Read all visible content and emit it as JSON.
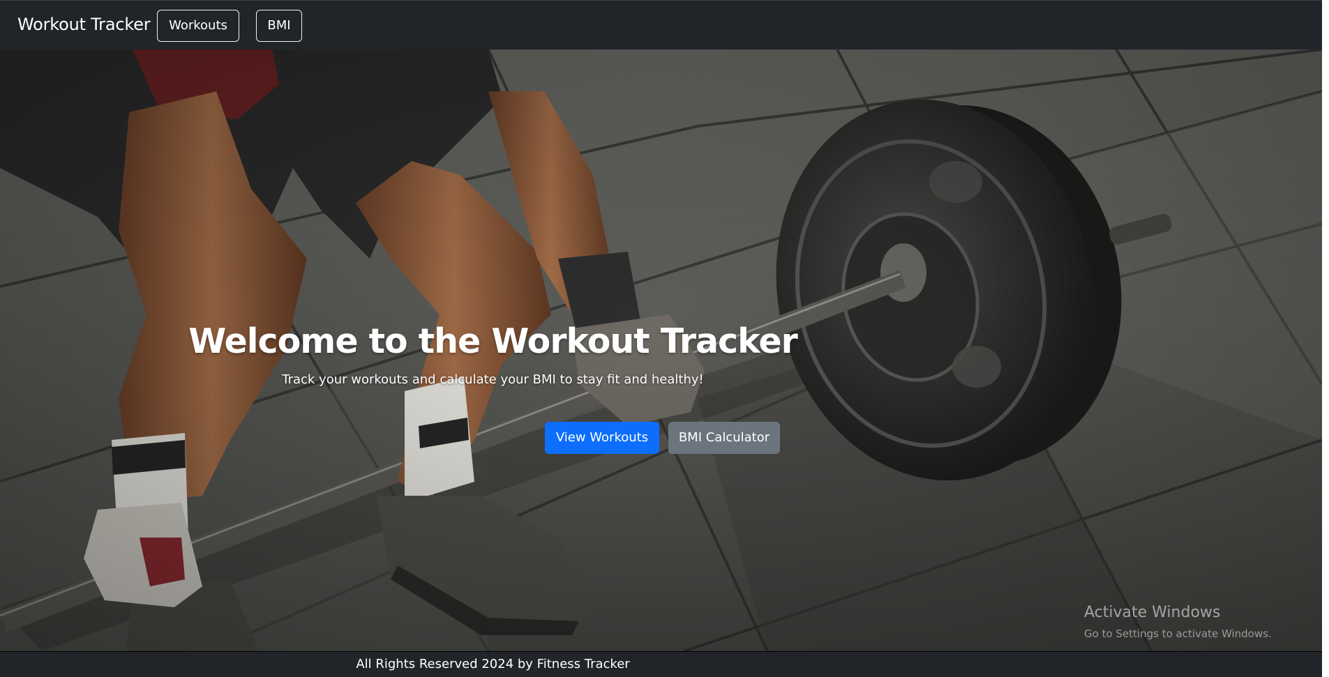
{
  "navbar": {
    "brand": "Workout Tracker",
    "links": [
      {
        "label": "Workouts"
      },
      {
        "label": "BMI"
      }
    ]
  },
  "hero": {
    "title": "Welcome to the Workout Tracker",
    "subtitle": "Track your workouts and calculate your BMI to stay fit and healthy!",
    "buttons": [
      {
        "label": "View Workouts"
      },
      {
        "label": "BMI Calculator"
      }
    ],
    "background_image": "barbell-deadlift-photo"
  },
  "watermark": {
    "title": "Activate Windows",
    "subtitle": "Go to Settings to activate Windows."
  },
  "footer": {
    "text": "All Rights Reserved 2024 by Fitness Tracker"
  },
  "colors": {
    "navbar_bg": "#212529",
    "primary_button": "#0d6efd",
    "secondary_button": "#6c757d"
  }
}
